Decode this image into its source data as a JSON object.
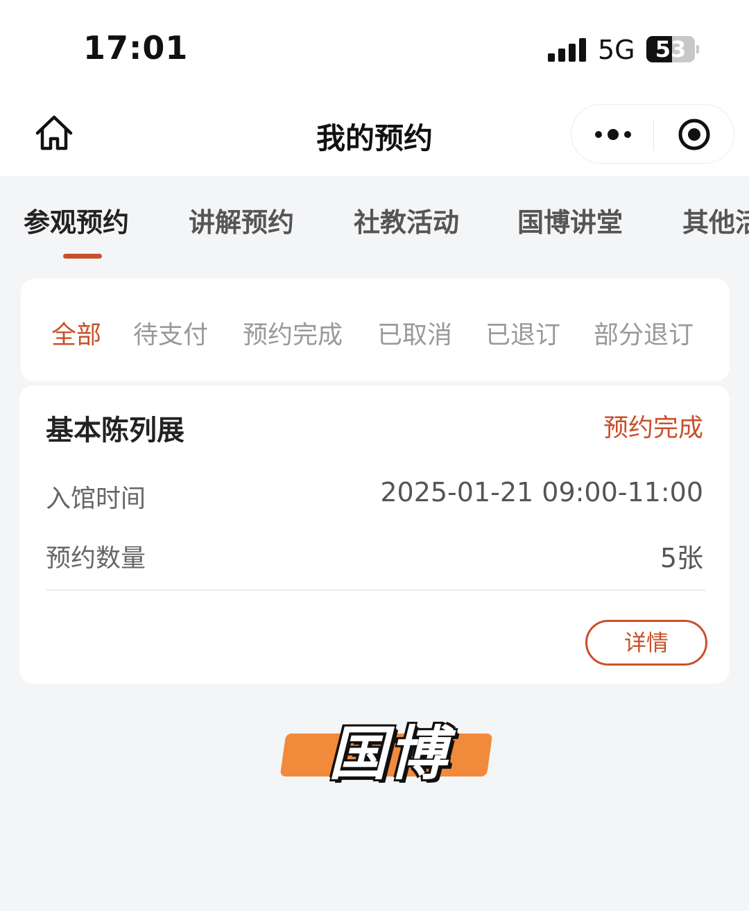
{
  "status_bar": {
    "time": "17:01",
    "network": "5G",
    "battery": "53",
    "battery_level": 0.53,
    "icons": [
      "signal-icon",
      "battery-icon"
    ]
  },
  "nav": {
    "title": "我的预约",
    "icons": [
      "home-icon",
      "more-icon",
      "target-icon"
    ]
  },
  "tabs": [
    {
      "label": "参观预约",
      "active": true
    },
    {
      "label": "讲解预约",
      "active": false
    },
    {
      "label": "社教活动",
      "active": false
    },
    {
      "label": "国博讲堂",
      "active": false
    },
    {
      "label": "其他活",
      "active": false
    }
  ],
  "filters": [
    {
      "label": "全部",
      "active": true
    },
    {
      "label": "待支付",
      "active": false
    },
    {
      "label": "预约完成",
      "active": false
    },
    {
      "label": "已取消",
      "active": false
    },
    {
      "label": "已退订",
      "active": false
    },
    {
      "label": "部分退订",
      "active": false
    }
  ],
  "order": {
    "title": "基本陈列展",
    "status": "预约完成",
    "entry_time_label": "入馆时间",
    "entry_time_value": "2025-01-21 09:00-11:00",
    "quantity_label": "预约数量",
    "quantity_value": "5张",
    "detail_button": "详情"
  },
  "watermark": {
    "text": "国博"
  },
  "colors": {
    "accent": "#c8502a",
    "background": "#f4f5f7",
    "watermark_stroke": "#f28a3c"
  }
}
